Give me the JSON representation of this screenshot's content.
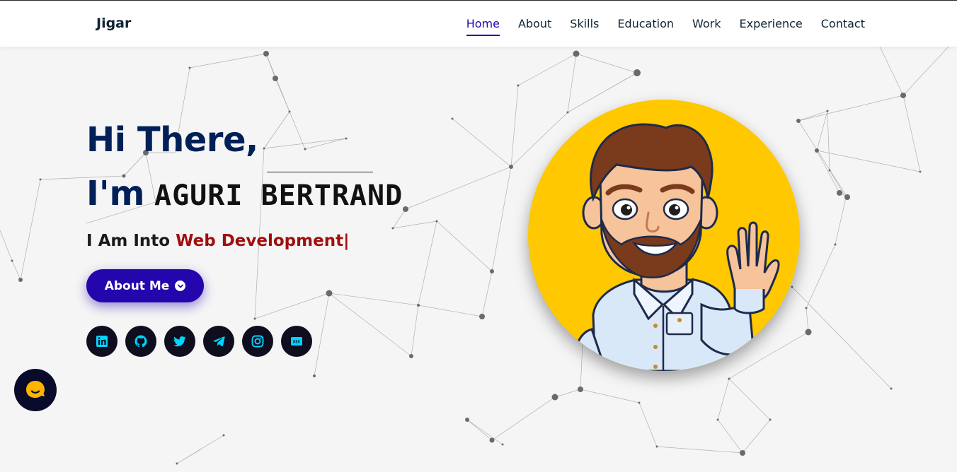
{
  "nav": {
    "brand": "Jigar",
    "items": [
      {
        "label": "Home",
        "active": true
      },
      {
        "label": "About",
        "active": false
      },
      {
        "label": "Skills",
        "active": false
      },
      {
        "label": "Education",
        "active": false
      },
      {
        "label": "Work",
        "active": false
      },
      {
        "label": "Experience",
        "active": false
      },
      {
        "label": "Contact",
        "active": false
      }
    ]
  },
  "hero": {
    "greeting": "Hi There,",
    "iam": "I'm",
    "name": "AGURI  BERTRAND",
    "tagline_prefix": "I Am Into ",
    "tagline_accent": "Web Development|",
    "button_label": "About Me"
  },
  "socials": [
    {
      "icon": "linkedin-icon"
    },
    {
      "icon": "github-icon"
    },
    {
      "icon": "twitter-icon"
    },
    {
      "icon": "telegram-icon"
    },
    {
      "icon": "instagram-icon"
    },
    {
      "icon": "dev-icon",
      "label": "DEV"
    }
  ],
  "colors": {
    "primary": "#2506ad",
    "heading": "#002057",
    "accent": "#a10e0e",
    "avatar_bg": "#ffc800",
    "social_bg": "#0e0e1e",
    "social_icon": "#00d4ff"
  }
}
